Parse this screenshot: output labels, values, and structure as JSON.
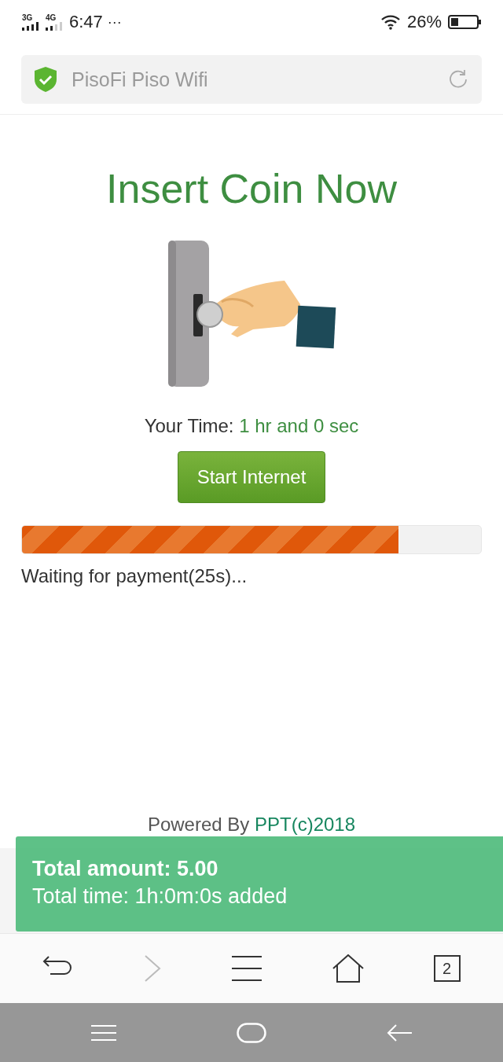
{
  "status_bar": {
    "networks": [
      "3G",
      "4G"
    ],
    "time": "6:47",
    "more": "···",
    "battery": "26%"
  },
  "address_bar": {
    "title": "PisoFi Piso Wifi"
  },
  "portal": {
    "heading": "Insert Coin Now",
    "time_label": "Your Time:",
    "time_value": "1 hr and 0 sec",
    "start_button": "Start Internet",
    "progress": {
      "level": 0.82
    },
    "waiting": "Waiting for payment(25s)..."
  },
  "footer": {
    "prefix": "Powered By",
    "link": "PPT(c)2018"
  },
  "toast": {
    "amount": "Total amount: 5.00",
    "time": "Total time: 1h:0m:0s added"
  },
  "browser_toolbar": {
    "tab_count": "2"
  }
}
